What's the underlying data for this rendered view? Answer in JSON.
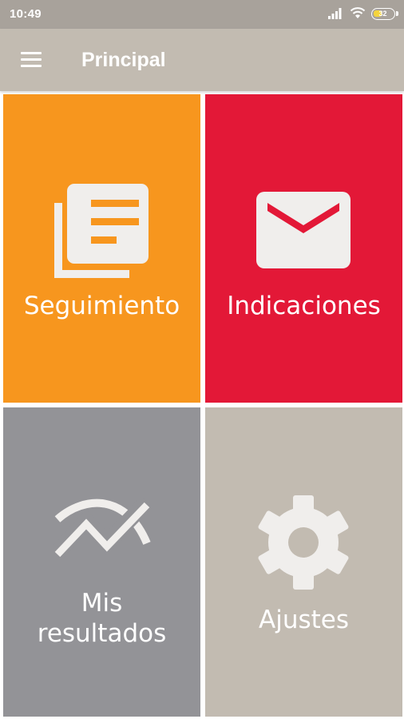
{
  "status_bar": {
    "time": "10:49",
    "battery": "32"
  },
  "app_bar": {
    "title": "Principal",
    "menu_icon": "hamburger-menu-icon"
  },
  "tiles": [
    {
      "label": "Seguimiento",
      "icon": "documents-icon",
      "color": "#f7961e"
    },
    {
      "label": "Indicaciones",
      "icon": "envelope-icon",
      "color": "#e31837"
    },
    {
      "label_line1": "Mis",
      "label_line2": "resultados",
      "icon": "trend-chart-icon",
      "color": "#939397"
    },
    {
      "label": "Ajustes",
      "icon": "gear-icon",
      "color": "#c2bbb1"
    }
  ],
  "colors": {
    "status_bar": "#a8a29b",
    "app_bar": "#c2bbb1",
    "icon": "#f0eeec"
  }
}
